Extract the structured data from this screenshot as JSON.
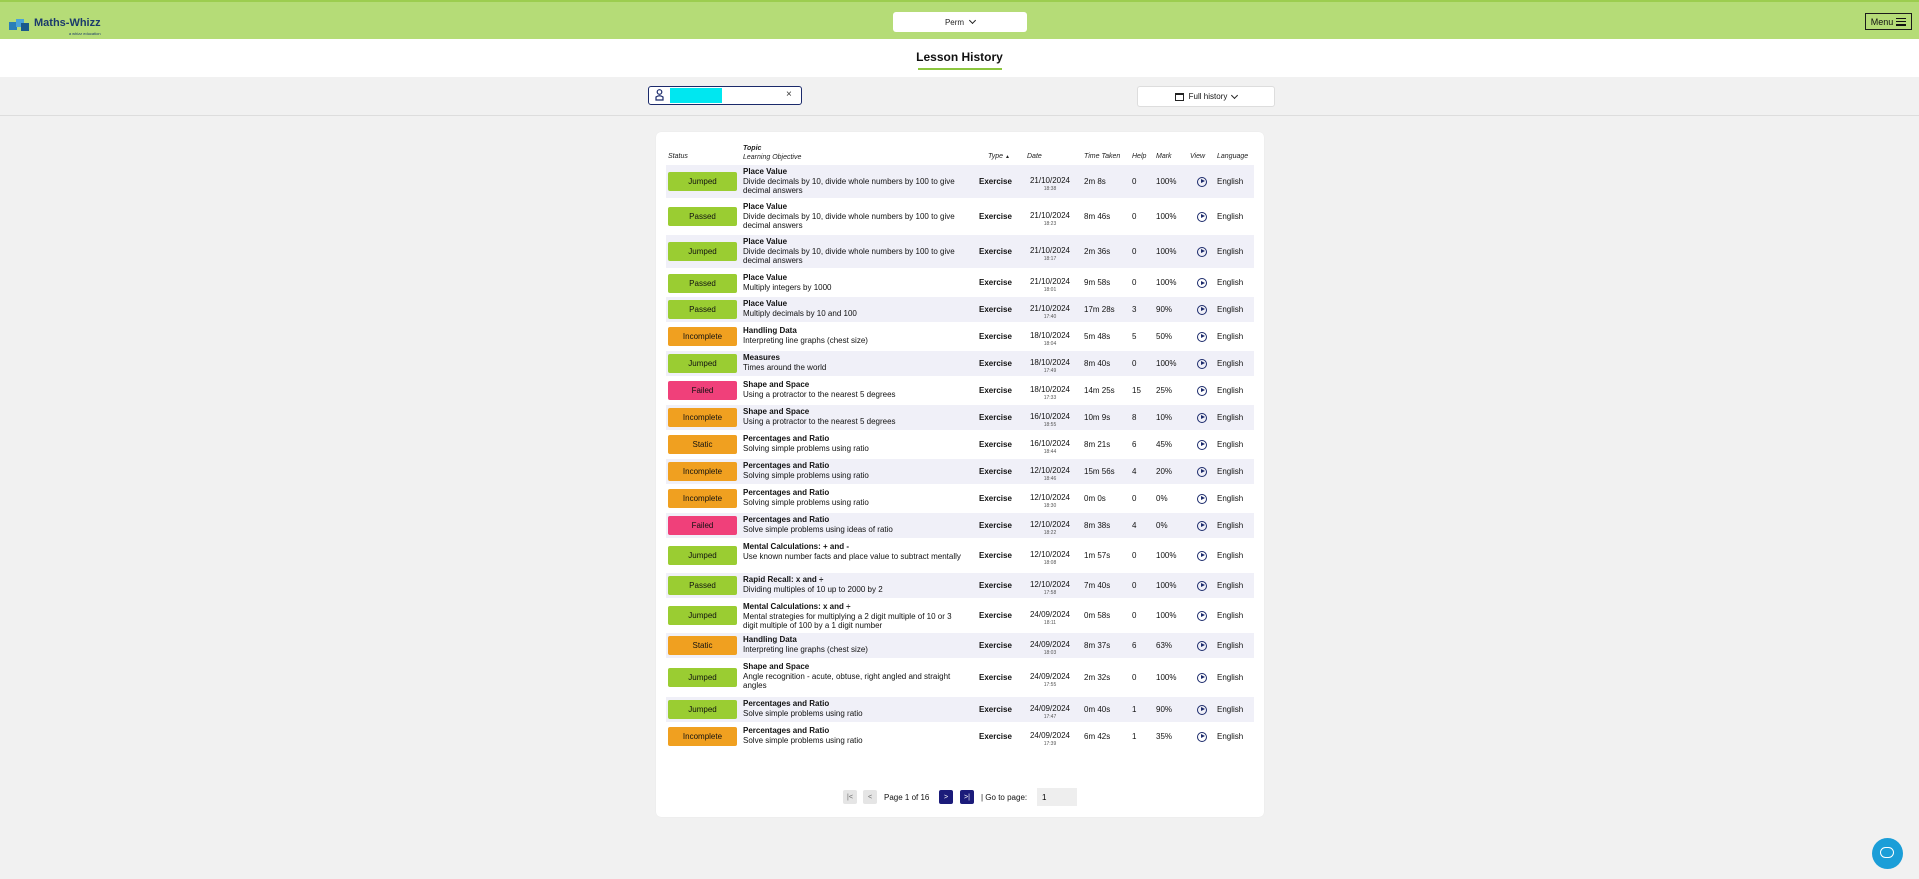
{
  "brand": {
    "name": "Maths-Whizz",
    "sub": "a whizz education"
  },
  "header": {
    "student_select": "Perm",
    "menu_label": "Menu"
  },
  "page": {
    "title": "Lesson History"
  },
  "filters": {
    "history_label": "Full history",
    "clear": "×"
  },
  "table": {
    "headers": {
      "status": "Status",
      "topic": "Topic",
      "objective": "Learning Objective",
      "type": "Type",
      "type_sort": "▲",
      "date": "Date",
      "time_taken": "Time Taken",
      "help": "Help",
      "mark": "Mark",
      "view": "View",
      "language": "Language"
    },
    "rows": [
      {
        "status": "Jumped",
        "topic": "Place Value",
        "objective": "Divide decimals by 10, divide whole numbers by 100 to give decimal answers",
        "type": "Exercise",
        "date": "21/10/2024",
        "time": "18:38",
        "taken": "2m 8s",
        "help": "0",
        "mark": "100%",
        "language": "English"
      },
      {
        "status": "Passed",
        "topic": "Place Value",
        "objective": "Divide decimals by 10, divide whole numbers by 100 to give decimal answers",
        "type": "Exercise",
        "date": "21/10/2024",
        "time": "18:23",
        "taken": "8m 46s",
        "help": "0",
        "mark": "100%",
        "language": "English"
      },
      {
        "status": "Jumped",
        "topic": "Place Value",
        "objective": "Divide decimals by 10, divide whole numbers by 100 to give decimal answers",
        "type": "Exercise",
        "date": "21/10/2024",
        "time": "18:17",
        "taken": "2m 36s",
        "help": "0",
        "mark": "100%",
        "language": "English"
      },
      {
        "status": "Passed",
        "topic": "Place Value",
        "objective": "Multiply integers by 1000",
        "type": "Exercise",
        "date": "21/10/2024",
        "time": "18:01",
        "taken": "9m 58s",
        "help": "0",
        "mark": "100%",
        "language": "English"
      },
      {
        "status": "Passed",
        "topic": "Place Value",
        "objective": "Multiply decimals by 10 and 100",
        "type": "Exercise",
        "date": "21/10/2024",
        "time": "17:40",
        "taken": "17m 28s",
        "help": "3",
        "mark": "90%",
        "language": "English"
      },
      {
        "status": "Incomplete",
        "topic": "Handling Data",
        "objective": "Interpreting line graphs (chest size)",
        "type": "Exercise",
        "date": "18/10/2024",
        "time": "18:04",
        "taken": "5m 48s",
        "help": "5",
        "mark": "50%",
        "language": "English"
      },
      {
        "status": "Jumped",
        "topic": "Measures",
        "objective": "Times around the world",
        "type": "Exercise",
        "date": "18/10/2024",
        "time": "17:49",
        "taken": "8m 40s",
        "help": "0",
        "mark": "100%",
        "language": "English"
      },
      {
        "status": "Failed",
        "topic": "Shape and Space",
        "objective": "Using a protractor to the nearest 5 degrees",
        "type": "Exercise",
        "date": "18/10/2024",
        "time": "17:33",
        "taken": "14m 25s",
        "help": "15",
        "mark": "25%",
        "language": "English"
      },
      {
        "status": "Incomplete",
        "topic": "Shape and Space",
        "objective": "Using a protractor to the nearest 5 degrees",
        "type": "Exercise",
        "date": "16/10/2024",
        "time": "18:55",
        "taken": "10m 9s",
        "help": "8",
        "mark": "10%",
        "language": "English"
      },
      {
        "status": "Static",
        "topic": "Percentages and Ratio",
        "objective": "Solving simple problems using ratio",
        "type": "Exercise",
        "date": "16/10/2024",
        "time": "18:44",
        "taken": "8m 21s",
        "help": "6",
        "mark": "45%",
        "language": "English"
      },
      {
        "status": "Incomplete",
        "topic": "Percentages and Ratio",
        "objective": "Solving simple problems using ratio",
        "type": "Exercise",
        "date": "12/10/2024",
        "time": "18:46",
        "taken": "15m 56s",
        "help": "4",
        "mark": "20%",
        "language": "English"
      },
      {
        "status": "Incomplete",
        "topic": "Percentages and Ratio",
        "objective": "Solving simple problems using ratio",
        "type": "Exercise",
        "date": "12/10/2024",
        "time": "18:30",
        "taken": "0m 0s",
        "help": "0",
        "mark": "0%",
        "language": "English"
      },
      {
        "status": "Failed",
        "topic": "Percentages and Ratio",
        "objective": "Solve simple problems using ideas of ratio",
        "type": "Exercise",
        "date": "12/10/2024",
        "time": "18:22",
        "taken": "8m 38s",
        "help": "4",
        "mark": "0%",
        "language": "English"
      },
      {
        "status": "Jumped",
        "topic": "Mental Calculations: + and -",
        "objective": "Use known number facts and place value to subtract mentally",
        "type": "Exercise",
        "date": "12/10/2024",
        "time": "18:08",
        "taken": "1m 57s",
        "help": "0",
        "mark": "100%",
        "language": "English"
      },
      {
        "status": "Passed",
        "topic": "Rapid Recall: x and ÷",
        "objective": "Dividing multiples of 10 up to 2000 by 2",
        "type": "Exercise",
        "date": "12/10/2024",
        "time": "17:58",
        "taken": "7m 40s",
        "help": "0",
        "mark": "100%",
        "language": "English"
      },
      {
        "status": "Jumped",
        "topic": "Mental Calculations: x and ÷",
        "objective": "Mental strategies for multiplying a 2 digit multiple of 10 or 3 digit multiple of 100 by a 1 digit number",
        "type": "Exercise",
        "date": "24/09/2024",
        "time": "18:11",
        "taken": "0m 58s",
        "help": "0",
        "mark": "100%",
        "language": "English"
      },
      {
        "status": "Static",
        "topic": "Handling Data",
        "objective": "Interpreting line graphs (chest size)",
        "type": "Exercise",
        "date": "24/09/2024",
        "time": "18:03",
        "taken": "8m 37s",
        "help": "6",
        "mark": "63%",
        "language": "English"
      },
      {
        "status": "Jumped",
        "topic": "Shape and Space",
        "objective": "Angle recognition - acute, obtuse, right angled and straight angles",
        "type": "Exercise",
        "date": "24/09/2024",
        "time": "17:55",
        "taken": "2m 32s",
        "help": "0",
        "mark": "100%",
        "language": "English"
      },
      {
        "status": "Jumped",
        "topic": "Percentages and Ratio",
        "objective": "Solve simple problems using ratio",
        "type": "Exercise",
        "date": "24/09/2024",
        "time": "17:47",
        "taken": "0m 40s",
        "help": "1",
        "mark": "90%",
        "language": "English"
      },
      {
        "status": "Incomplete",
        "topic": "Percentages and Ratio",
        "objective": "Solve simple problems using ratio",
        "type": "Exercise",
        "date": "24/09/2024",
        "time": "17:39",
        "taken": "6m 42s",
        "help": "1",
        "mark": "35%",
        "language": "English"
      }
    ]
  },
  "status_colors": {
    "Jumped": "#9acd32",
    "Passed": "#9acd32",
    "Incomplete": "#f0a020",
    "Failed": "#f0407a",
    "Static": "#f0a020"
  },
  "pagination": {
    "first": "|<",
    "prev": "<",
    "page_text": "Page 1 of 16",
    "next": ">",
    "last": ">|",
    "goto_label": "| Go to page:",
    "goto_value": "1"
  }
}
